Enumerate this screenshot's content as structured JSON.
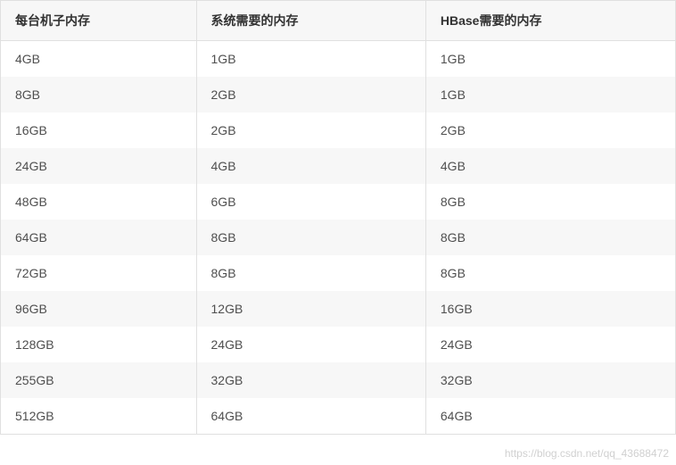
{
  "table": {
    "headers": [
      "每台机子内存",
      "系统需要的内存",
      "HBase需要的内存"
    ],
    "rows": [
      [
        "4GB",
        "1GB",
        "1GB"
      ],
      [
        "8GB",
        "2GB",
        "1GB"
      ],
      [
        "16GB",
        "2GB",
        "2GB"
      ],
      [
        "24GB",
        "4GB",
        "4GB"
      ],
      [
        "48GB",
        "6GB",
        "8GB"
      ],
      [
        "64GB",
        "8GB",
        "8GB"
      ],
      [
        "72GB",
        "8GB",
        "8GB"
      ],
      [
        "96GB",
        "12GB",
        "16GB"
      ],
      [
        "128GB",
        "24GB",
        "24GB"
      ],
      [
        "255GB",
        "32GB",
        "32GB"
      ],
      [
        "512GB",
        "64GB",
        "64GB"
      ]
    ]
  },
  "watermark": "https://blog.csdn.net/qq_43688472"
}
